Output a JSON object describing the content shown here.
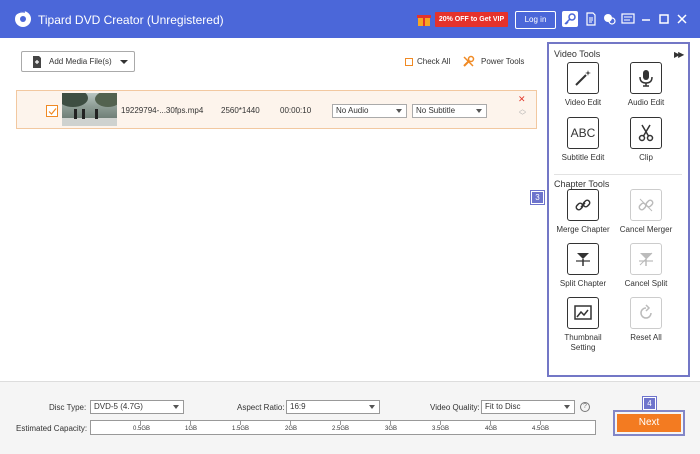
{
  "window": {
    "title": "Tipard DVD Creator (Unregistered)",
    "promo": "20% OFF to Get VIP",
    "login": "Log in"
  },
  "toolbar": {
    "add_media": "Add Media File(s)",
    "check_all": "Check All",
    "power_tools": "Power Tools"
  },
  "media": [
    {
      "filename": "19229794-...30fps.mp4",
      "resolution": "2560*1440",
      "duration": "00:00:10",
      "audio": "No Audio",
      "subtitle": "No Subtitle"
    }
  ],
  "tools": {
    "video_tools_title": "Video Tools",
    "chapter_tools_title": "Chapter Tools",
    "video_edit": "Video Edit",
    "audio_edit": "Audio Edit",
    "subtitle_edit": "Subtitle Edit",
    "clip": "Clip",
    "merge_chapter": "Merge Chapter",
    "cancel_merger": "Cancel Merger",
    "split_chapter": "Split Chapter",
    "cancel_split": "Cancel Split",
    "thumbnail_setting": "Thumbnail Setting",
    "reset_all": "Reset All",
    "abc_text": "ABC"
  },
  "badges": {
    "step3": "3",
    "step4": "4"
  },
  "bottom": {
    "disc_type_label": "Disc Type:",
    "disc_type": "DVD-5 (4.7G)",
    "aspect_label": "Aspect Ratio:",
    "aspect": "16:9",
    "quality_label": "Video Quality:",
    "quality": "Fit to Disc",
    "help": "?",
    "capacity_label": "Estimated Capacity:",
    "capacity_ticks": [
      "0.5GB",
      "1GB",
      "1.5GB",
      "2GB",
      "2.5GB",
      "3GB",
      "3.5GB",
      "4GB",
      "4.5GB"
    ],
    "next": "Next"
  },
  "colors": {
    "titlebar": "#4b67d9",
    "accent": "#f37b21",
    "panel_border": "#7377c6",
    "promo": "#e5322c"
  }
}
